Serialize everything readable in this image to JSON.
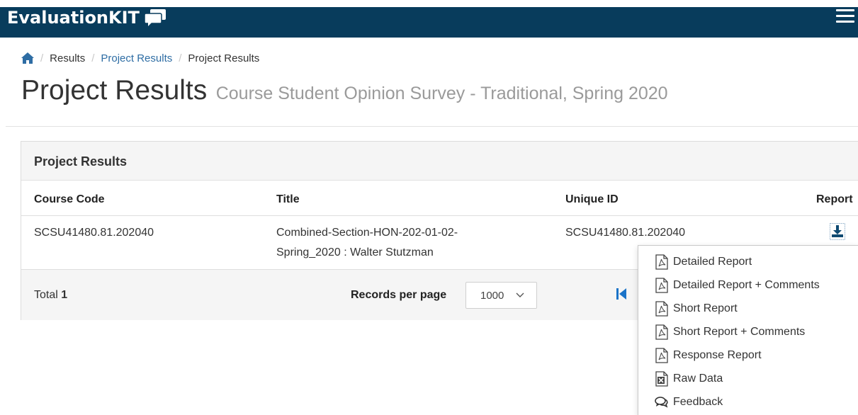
{
  "app": {
    "logo_text": "EvaluationKIT"
  },
  "breadcrumb": {
    "items": [
      "Results",
      "Project Results",
      "Project Results"
    ]
  },
  "page": {
    "title": "Project Results",
    "subtitle": "Course Student Opinion Survey - Traditional, Spring 2020"
  },
  "panel": {
    "heading": "Project Results",
    "columns": [
      "Course Code",
      "Title",
      "Unique ID",
      "Report"
    ],
    "rows": [
      {
        "course_code": "SCSU41480.81.202040",
        "title_line1": "Combined-Section-HON-202-01-02-",
        "title_line2": "Spring_2020 : Walter Stutzman",
        "unique_id": "SCSU41480.81.202040"
      }
    ],
    "footer": {
      "total_label": "Total",
      "total_value": "1",
      "records_per_page_label": "Records per page",
      "records_per_page_value": "1000"
    }
  },
  "report_menu": {
    "items": [
      {
        "label": "Detailed Report",
        "icon": "pdf-icon"
      },
      {
        "label": "Detailed Report + Comments",
        "icon": "pdf-icon"
      },
      {
        "label": "Short Report",
        "icon": "pdf-icon"
      },
      {
        "label": "Short Report + Comments",
        "icon": "pdf-icon"
      },
      {
        "label": "Response Report",
        "icon": "pdf-icon"
      },
      {
        "label": "Raw Data",
        "icon": "excel-icon"
      },
      {
        "label": "Feedback",
        "icon": "comments-icon"
      }
    ]
  },
  "colors": {
    "header_bg": "#083c5c",
    "link": "#2e6da4",
    "pager_accent": "#1a73c8"
  }
}
